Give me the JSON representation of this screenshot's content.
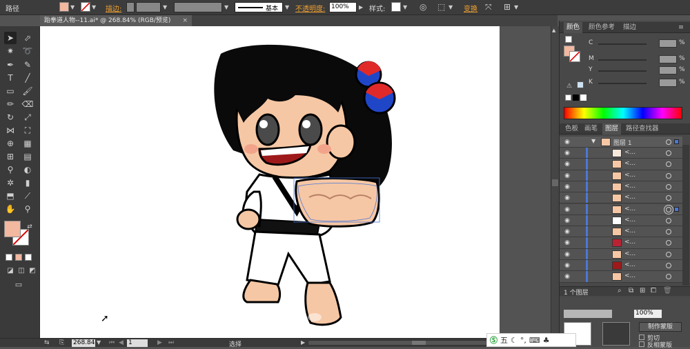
{
  "control_bar": {
    "object_type": "路径",
    "stroke_label": "描边:",
    "stroke_style": "基本",
    "opacity_label": "不透明度:",
    "opacity_value": "100%",
    "style_label": "样式:",
    "transform_label": "变换",
    "fill_color": "#f2b8a0"
  },
  "document": {
    "tab_title": "跆拳道人物--11.ai* @ 268.84% (RGB/预览)",
    "close_symbol": "×"
  },
  "status_bar": {
    "zoom": "268.84",
    "page": "1",
    "tool_status": "选择"
  },
  "color_panel": {
    "tabs": [
      "颜色",
      "颜色参考",
      "描边"
    ],
    "channels": [
      {
        "label": "C",
        "unit": "%"
      },
      {
        "label": "M",
        "unit": "%"
      },
      {
        "label": "Y",
        "unit": "%"
      },
      {
        "label": "K",
        "unit": "%"
      }
    ]
  },
  "layers_panel": {
    "tabs": [
      "色板",
      "画笔",
      "图层",
      "路径查找器"
    ],
    "top_layer": "图层 1",
    "rows": [
      {
        "name": "<...",
        "target": "hollow"
      },
      {
        "name": "<...",
        "target": "hollow"
      },
      {
        "name": "<...",
        "target": "hollow"
      },
      {
        "name": "<...",
        "target": "hollow"
      },
      {
        "name": "<...",
        "target": "hollow"
      },
      {
        "name": "<...",
        "target": "double",
        "selected": true
      },
      {
        "name": "<...",
        "target": "hollow"
      },
      {
        "name": "<...",
        "target": "hollow"
      },
      {
        "name": "<...",
        "target": "hollow"
      },
      {
        "name": "<...",
        "target": "hollow"
      },
      {
        "name": "<...",
        "target": "hollow"
      },
      {
        "name": "<...",
        "target": "hollow"
      }
    ],
    "footer": "1 个图层"
  },
  "transparency_panel": {
    "make_mask": "制作蒙版",
    "clip": "剪切",
    "invert_mask": "反相蒙版",
    "opacity_value": "100%"
  },
  "taskbar": {
    "ime": "五"
  },
  "colors": {
    "accent": "#4b78d8",
    "fill": "#f2b8a0"
  }
}
